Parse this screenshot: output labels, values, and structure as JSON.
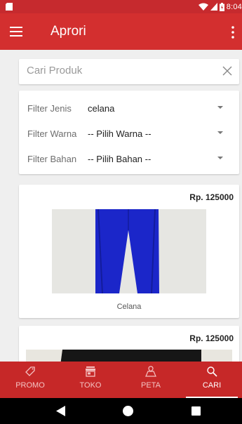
{
  "status_bar": {
    "time": "8:04",
    "icons": [
      "sd-card-icon",
      "wifi-icon",
      "signal-icon",
      "battery-icon"
    ]
  },
  "app_bar": {
    "title": "Aprori",
    "menu_icon": "hamburger-menu-icon",
    "overflow_icon": "more-vertical-icon"
  },
  "search": {
    "placeholder": "Cari Produk",
    "value": "",
    "clear_icon": "close-icon"
  },
  "filters": [
    {
      "label": "Filter Jenis",
      "value": "celana"
    },
    {
      "label": "Filter Warna",
      "value": "-- Pilih Warna --"
    },
    {
      "label": "Filter Bahan",
      "value": "-- Pilih Bahan --"
    }
  ],
  "products": [
    {
      "price": "Rp. 125000",
      "name": "Celana"
    },
    {
      "price": "Rp. 125000",
      "name": ""
    }
  ],
  "bottom_nav": {
    "items": [
      {
        "label": "PROMO",
        "icon": "tag-icon",
        "active": false
      },
      {
        "label": "TOKO",
        "icon": "store-icon",
        "active": false
      },
      {
        "label": "PETA",
        "icon": "map-icon",
        "active": false
      },
      {
        "label": "CARI",
        "icon": "search-icon",
        "active": true
      }
    ]
  },
  "colors": {
    "primary": "#d32f2f",
    "status_bar": "#c62a2e",
    "bottom_nav": "#c62828",
    "background": "#efefef"
  }
}
